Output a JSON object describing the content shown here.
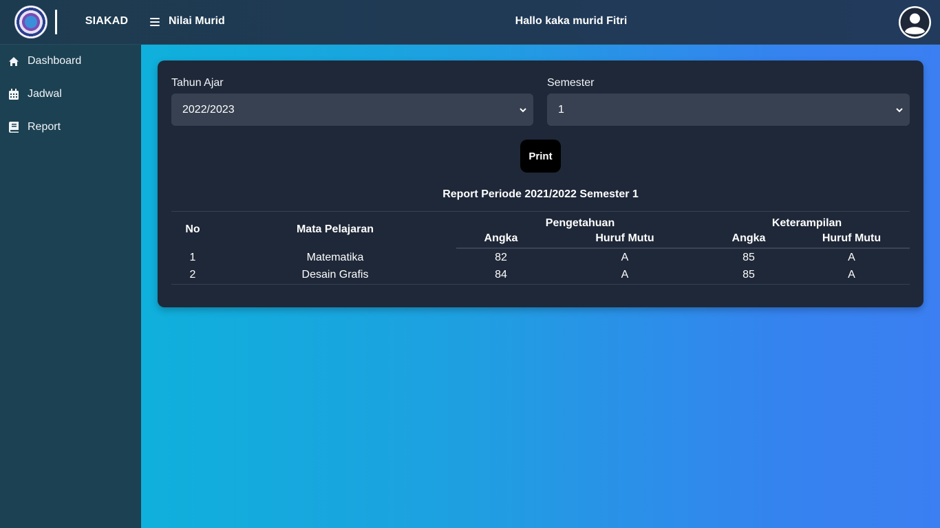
{
  "header": {
    "brand": "SIAKAD",
    "page_title": "Nilai Murid",
    "greeting": "Hallo kaka murid Fitri"
  },
  "sidebar": {
    "items": [
      {
        "label": "Dashboard",
        "icon": "home-icon"
      },
      {
        "label": "Jadwal",
        "icon": "calendar-icon"
      },
      {
        "label": "Report",
        "icon": "book-icon"
      }
    ]
  },
  "filters": {
    "year": {
      "label": "Tahun Ajar",
      "value": "2022/2023"
    },
    "semester": {
      "label": "Semester",
      "value": "1"
    },
    "print_label": "Print"
  },
  "report": {
    "title": "Report Periode 2021/2022 Semester 1",
    "headers": {
      "no": "No",
      "subject": "Mata Pelajaran",
      "knowledge": "Pengetahuan",
      "skills": "Keterampilan",
      "score": "Angka",
      "grade": "Huruf Mutu"
    },
    "rows": [
      {
        "no": "1",
        "subject": "Matematika",
        "k_score": "82",
        "k_grade": "A",
        "s_score": "85",
        "s_grade": "A"
      },
      {
        "no": "2",
        "subject": "Desain Grafis",
        "k_score": "84",
        "k_grade": "A",
        "s_score": "85",
        "s_grade": "A"
      }
    ]
  },
  "colors": {
    "header_bg": "#1d3b4f",
    "sidebar_bg": "#1c4152",
    "card_bg": "#1f2838",
    "select_bg": "#374151",
    "main_gradient_start": "#0fb0dc",
    "main_gradient_end": "#3b7ff2"
  }
}
